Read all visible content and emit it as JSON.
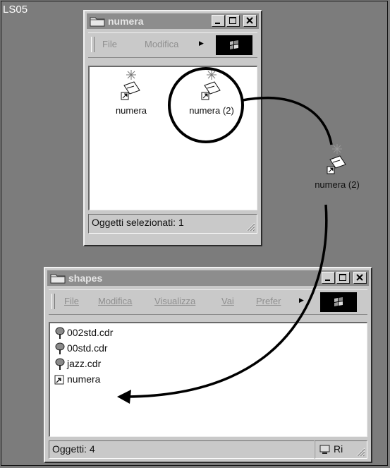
{
  "page_label": "LS05",
  "top_window": {
    "title": "numera",
    "menu": {
      "file": "File",
      "edit": "Modifica"
    },
    "icons": [
      {
        "label": "numera"
      },
      {
        "label": "numera (2)"
      }
    ],
    "status": "Oggetti selezionati: 1"
  },
  "drag_ghost": {
    "label": "numera (2)"
  },
  "bottom_window": {
    "title": "shapes",
    "menu": {
      "file": "File",
      "edit": "Modifica",
      "view": "Visualizza",
      "go": "Vai",
      "favorites": "Prefer"
    },
    "files": [
      {
        "name": "002std.cdr",
        "icon": "coreldraw-file-icon"
      },
      {
        "name": "00std.cdr",
        "icon": "coreldraw-file-icon"
      },
      {
        "name": "jazz.cdr",
        "icon": "coreldraw-file-icon"
      },
      {
        "name": "numera",
        "icon": "shortcut-icon"
      }
    ],
    "status": "Oggetti: 4",
    "status_right": "Ri"
  },
  "colors": {
    "background": "#7c7c7c",
    "titlebar_inactive": "#8d8d8d",
    "window": "#c9c9c9"
  }
}
